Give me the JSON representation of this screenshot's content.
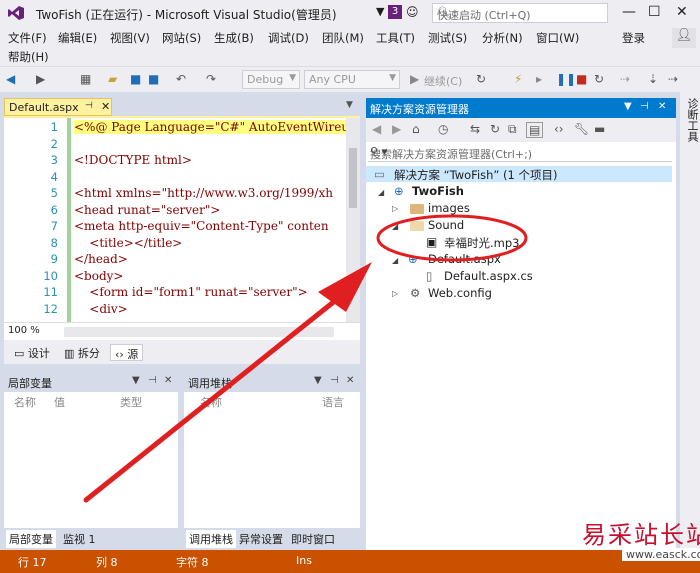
{
  "window": {
    "title": "TwoFish (正在运行) - Microsoft Visual Studio(管理员)",
    "notification_count": "3",
    "quick_launch_placeholder": "快速启动 (Ctrl+Q)",
    "sign_in": "登录"
  },
  "menu": {
    "row1": [
      "文件(F)",
      "编辑(E)",
      "视图(V)",
      "网站(S)",
      "生成(B)",
      "调试(D)",
      "团队(M)",
      "工具(T)",
      "测试(S)",
      "分析(N)",
      "窗口(W)"
    ],
    "help": "帮助(H)"
  },
  "toolbar": {
    "config": "Debug",
    "platform": "Any CPU",
    "continue": "继续(C)"
  },
  "editor": {
    "tab_label": "Default.aspx",
    "zoom": "100 %",
    "line_numbers": [
      "1",
      "2",
      "3",
      "4",
      "5",
      "6",
      "7",
      "8",
      "9",
      "10",
      "11",
      "12"
    ],
    "lines": [
      "<%@ Page Language=\"C#\" AutoEventWireup=",
      "",
      "<!DOCTYPE html>",
      "",
      "<html xmlns=\"http://www.w3.org/1999/xh",
      "<head runat=\"server\">",
      "<meta http-equiv=\"Content-Type\" conten",
      "    <title></title>",
      "</head>",
      "<body>",
      "    <form id=\"form1\" runat=\"server\">",
      "    <div>"
    ],
    "view_tabs": [
      "设计",
      "拆分",
      "源"
    ]
  },
  "locals_panel": {
    "title": "局部变量",
    "columns": [
      "名称",
      "值",
      "类型"
    ],
    "tabs": [
      "局部变量",
      "监视 1"
    ]
  },
  "callstack_panel": {
    "title": "调用堆栈",
    "columns": [
      "名称",
      "语言"
    ],
    "tabs": [
      "调用堆栈",
      "异常设置",
      "即时窗口"
    ]
  },
  "solution_explorer": {
    "title": "解决方案资源管理器",
    "search_placeholder": "搜索解决方案资源管理器(Ctrl+;)",
    "solution_label": "解决方案 “TwoFish” (1 个项目)",
    "project": "TwoFish",
    "items": {
      "images": "images",
      "sound": "Sound",
      "mp3": "幸福时光.mp3",
      "default_aspx": "Default.aspx",
      "default_cs": "Default.aspx.cs",
      "web_config": "Web.config"
    }
  },
  "right_strip": "诊断工具",
  "status": {
    "line": "行 17",
    "col": "列 8",
    "char": "字符 8",
    "mode": "Ins"
  },
  "watermark": {
    "text": "易采站长站",
    "url": "www.easck.com"
  },
  "colors": {
    "accent_blue": "#007acc",
    "status_orange": "#ca5100",
    "annotation_red": "#e02020"
  }
}
